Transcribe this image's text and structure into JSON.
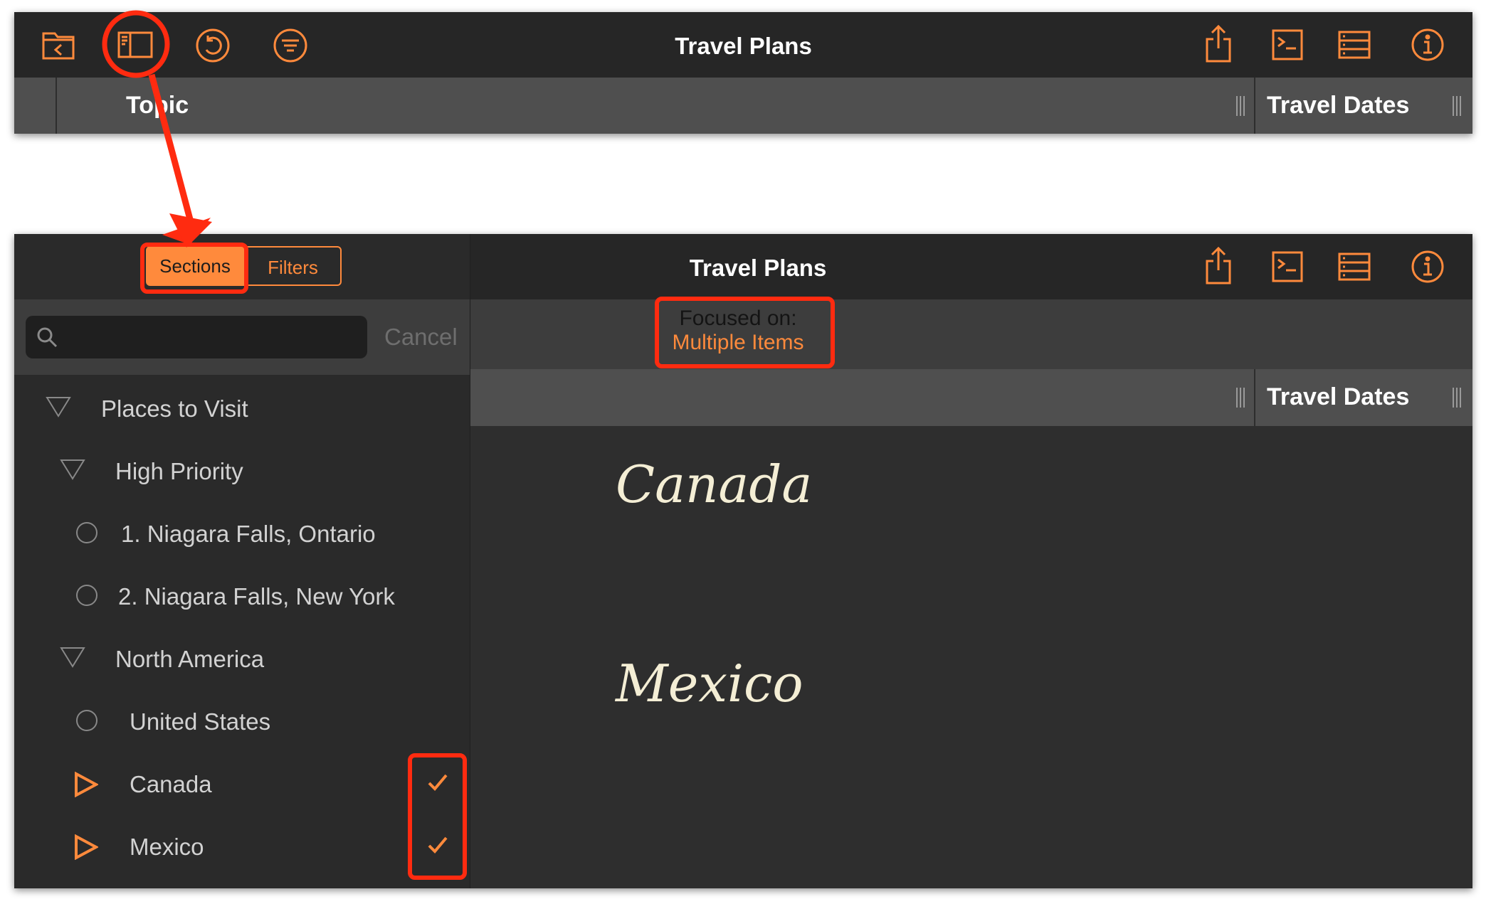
{
  "colors": {
    "accent": "#ff8a3c",
    "annotation": "#ff2b10",
    "toolbar": "#262626",
    "sidebar": "#2a2a2a",
    "header": "#4f4f4f"
  },
  "top_window": {
    "title": "Travel Plans",
    "toolbar_icons_left": [
      "folder-back-icon",
      "sidebar-toggle-icon",
      "undo-icon",
      "filter-icon"
    ],
    "toolbar_icons_right": [
      "share-icon",
      "console-icon",
      "columns-icon",
      "info-icon"
    ],
    "columns": [
      "Topic",
      "Travel Dates"
    ]
  },
  "bottom_window": {
    "title": "Travel Plans",
    "tabs": [
      {
        "label": "Sections",
        "selected": true
      },
      {
        "label": "Filters",
        "selected": false
      }
    ],
    "search": {
      "placeholder": "",
      "cancel_label": "Cancel"
    },
    "outline": [
      {
        "label": "Places to Visit",
        "mark": "triangle-down-icon",
        "checked": false
      },
      {
        "label": "High Priority",
        "mark": "triangle-down-icon",
        "checked": false
      },
      {
        "label": "1.  Niagara Falls, Ontario",
        "mark": "circle-icon",
        "checked": false
      },
      {
        "label": "2.  Niagara Falls, New York",
        "mark": "circle-icon",
        "checked": false
      },
      {
        "label": "North America",
        "mark": "triangle-down-icon",
        "checked": false
      },
      {
        "label": "United States",
        "mark": "circle-icon",
        "checked": false
      },
      {
        "label": "Canada",
        "mark": "triangle-right-icon",
        "checked": true
      },
      {
        "label": "Mexico",
        "mark": "triangle-right-icon",
        "checked": true
      }
    ],
    "focus": {
      "line1": "Focused on:",
      "line2": "Multiple Items"
    },
    "column": "Travel Dates",
    "content_items": [
      "Canada",
      "Mexico"
    ]
  }
}
